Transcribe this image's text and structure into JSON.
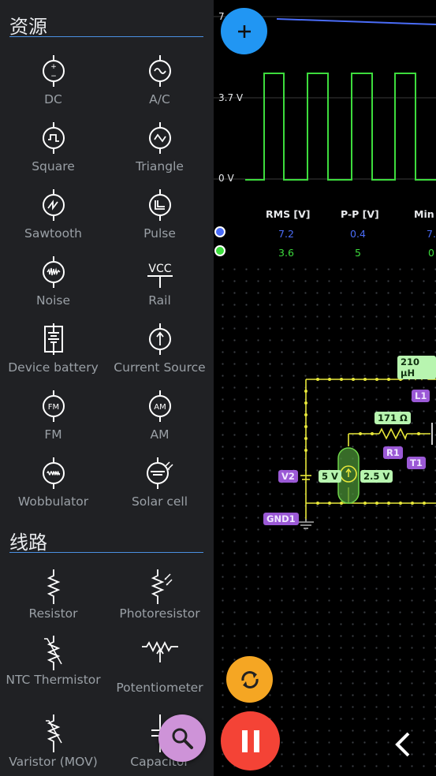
{
  "sources": {
    "title": "资源",
    "items": [
      {
        "label": "DC",
        "icon": "dc-source-icon"
      },
      {
        "label": "A/C",
        "icon": "ac-source-icon"
      },
      {
        "label": "Square",
        "icon": "square-source-icon"
      },
      {
        "label": "Triangle",
        "icon": "triangle-source-icon"
      },
      {
        "label": "Sawtooth",
        "icon": "sawtooth-source-icon"
      },
      {
        "label": "Pulse",
        "icon": "pulse-source-icon"
      },
      {
        "label": "Noise",
        "icon": "noise-source-icon"
      },
      {
        "label": "Rail",
        "icon": "rail-icon",
        "icon_text": "VCC"
      },
      {
        "label": "Device battery",
        "icon": "battery-icon"
      },
      {
        "label": "Current Source",
        "icon": "current-source-icon"
      },
      {
        "label": "FM",
        "icon": "fm-source-icon",
        "icon_text": "FM"
      },
      {
        "label": "AM",
        "icon": "am-source-icon",
        "icon_text": "AM"
      },
      {
        "label": "Wobbulator",
        "icon": "wobbulator-icon"
      },
      {
        "label": "Solar cell",
        "icon": "solar-cell-icon"
      }
    ]
  },
  "circuits": {
    "title": "线路",
    "items": [
      {
        "label": "Resistor",
        "icon": "resistor-icon"
      },
      {
        "label": "Photoresistor",
        "icon": "photoresistor-icon"
      },
      {
        "label": "NTC Thermistor",
        "icon": "ntc-thermistor-icon"
      },
      {
        "label": "Potentiometer",
        "icon": "potentiometer-icon"
      },
      {
        "label": "Varistor (MOV)",
        "icon": "varistor-icon"
      },
      {
        "label": "Capacitor",
        "icon": "capacitor-icon"
      }
    ]
  },
  "scope": {
    "y_top": "7",
    "y_mid": "3.7 V",
    "y_zero": "0 V",
    "headers": {
      "rms": "RMS [V]",
      "pp": "P-P [V]",
      "min": "Min ["
    },
    "rows": [
      {
        "color": "#4a6cf7",
        "rms": "7.2",
        "pp": "0.4",
        "min": "7."
      },
      {
        "color": "#3ddc3d",
        "rms": "3.6",
        "pp": "5",
        "min": "0"
      }
    ]
  },
  "circuit": {
    "inductor_value": "210 µH",
    "inductor_name": "L1",
    "resistor_value": "171 Ω",
    "resistor_name": "R1",
    "transistor_name": "T1",
    "source_name": "V2",
    "source_amplitude": "5 V",
    "source_offset": "2.5 V",
    "ground_name": "GND1"
  },
  "colors": {
    "panel_bg": "#202124",
    "accent_blue": "#2196f3",
    "pause_red": "#f44336",
    "refresh_orange": "#f5a623",
    "search_pink": "#ce93d8",
    "trace_green": "#3ddc3d",
    "trace_blue": "#4a6cf7"
  }
}
